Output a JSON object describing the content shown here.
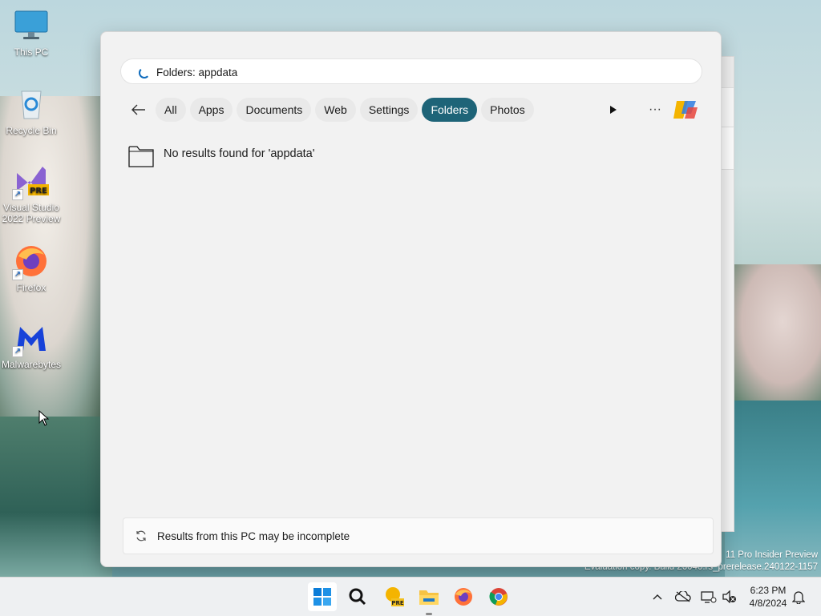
{
  "desktop": {
    "icons": [
      {
        "label": "This PC"
      },
      {
        "label": "Recycle Bin"
      },
      {
        "label": "Visual Studio 2022 Preview"
      },
      {
        "label": "Firefox"
      },
      {
        "label": "Malwarebytes"
      }
    ],
    "vs_badge": "PRE",
    "watermark": {
      "line1": "11 Pro Insider Preview",
      "line2": "Evaluation copy. Build 26040.rs_prerelease.240122-1157"
    }
  },
  "search": {
    "query": "Folders: appdata",
    "filters": [
      {
        "label": "All",
        "active": false
      },
      {
        "label": "Apps",
        "active": false
      },
      {
        "label": "Documents",
        "active": false
      },
      {
        "label": "Web",
        "active": false
      },
      {
        "label": "Settings",
        "active": false
      },
      {
        "label": "Folders",
        "active": true
      },
      {
        "label": "Photos",
        "active": false
      }
    ],
    "more_label": "···",
    "no_results": "No results found for 'appdata'",
    "footer": "Results from this PC may be incomplete"
  },
  "taskbar": {
    "vs_badge": "PRE",
    "time": "6:23 PM",
    "date": "4/8/2024"
  },
  "colors": {
    "accent_chip": "#1e6478",
    "spinner": "#0f6cbd"
  }
}
